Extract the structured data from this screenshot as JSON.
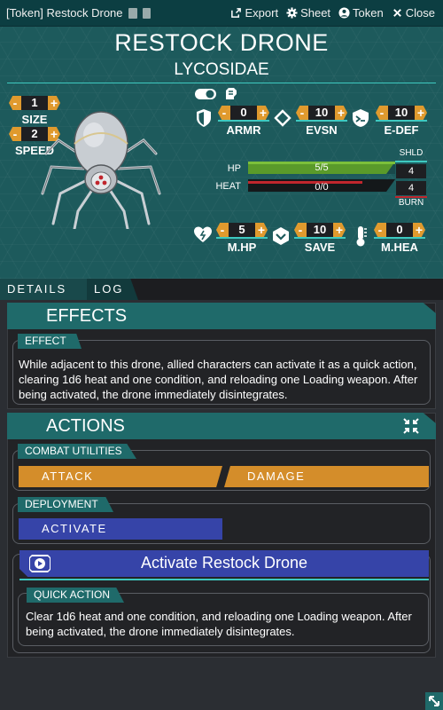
{
  "window": {
    "title": "[Token] Restock Drone",
    "export_label": "Export",
    "sheet_label": "Sheet",
    "token_label": "Token",
    "close_label": "Close"
  },
  "header": {
    "name": "RESTOCK DRONE",
    "subname": "LYCOSIDAE"
  },
  "stats": {
    "size": {
      "label": "SIZE",
      "value": "1"
    },
    "speed": {
      "label": "SPEED",
      "value": "2"
    },
    "armor": {
      "label": "ARMR",
      "value": "0"
    },
    "evasion": {
      "label": "EVSN",
      "value": "10"
    },
    "edef": {
      "label": "E-DEF",
      "value": "10"
    },
    "mhp": {
      "label": "M.HP",
      "value": "5"
    },
    "save": {
      "label": "SAVE",
      "value": "10"
    },
    "mheat": {
      "label": "M.HEA",
      "value": "0"
    }
  },
  "bars": {
    "hp": {
      "label": "HP",
      "text": "5/5",
      "fill": 1.0
    },
    "heat": {
      "label": "HEAT",
      "text": "0/0",
      "fill": 0.0
    },
    "shield": {
      "label": "SHLD",
      "value": "4"
    },
    "burn": {
      "label": "BURN",
      "value": "4"
    }
  },
  "tabs": {
    "details": "DETAILS",
    "log": "LOG"
  },
  "effects": {
    "title": "EFFECTS",
    "tag": "EFFECT",
    "text": "While adjacent to this drone, allied characters can activate it as a quick action, clearing 1d6 heat and one condition, and reloading one Loading weapon. After being activated, the drone immediately disintegrates."
  },
  "actions": {
    "title": "ACTIONS",
    "combat_tag": "COMBAT UTILITIES",
    "attack_label": "ATTACK",
    "damage_label": "DAMAGE",
    "deployment_tag": "DEPLOYMENT",
    "activate_label": "ACTIVATE"
  },
  "activate_panel": {
    "title": "Activate Restock Drone",
    "tag": "QUICK ACTION",
    "text": "Clear 1d6 heat and one condition, and reloading one Loading weapon. After being activated, the drone immediately disintegrates."
  },
  "colors": {
    "teal": "#1f6a6a",
    "orange": "#d48d2a",
    "blue": "#3644a8",
    "hp_green": "#5a9a2a",
    "heat_red": "#c0262d"
  },
  "icons": [
    "export-icon",
    "gear-icon",
    "user-icon",
    "close-icon",
    "shield-icon",
    "diamond-arrow-icon",
    "e-defense-icon",
    "heart-icon",
    "save-icon",
    "thermometer-icon",
    "collapse-icon",
    "activate-icon",
    "resize-icon",
    "toggle-icon",
    "tech-hand-icon"
  ]
}
